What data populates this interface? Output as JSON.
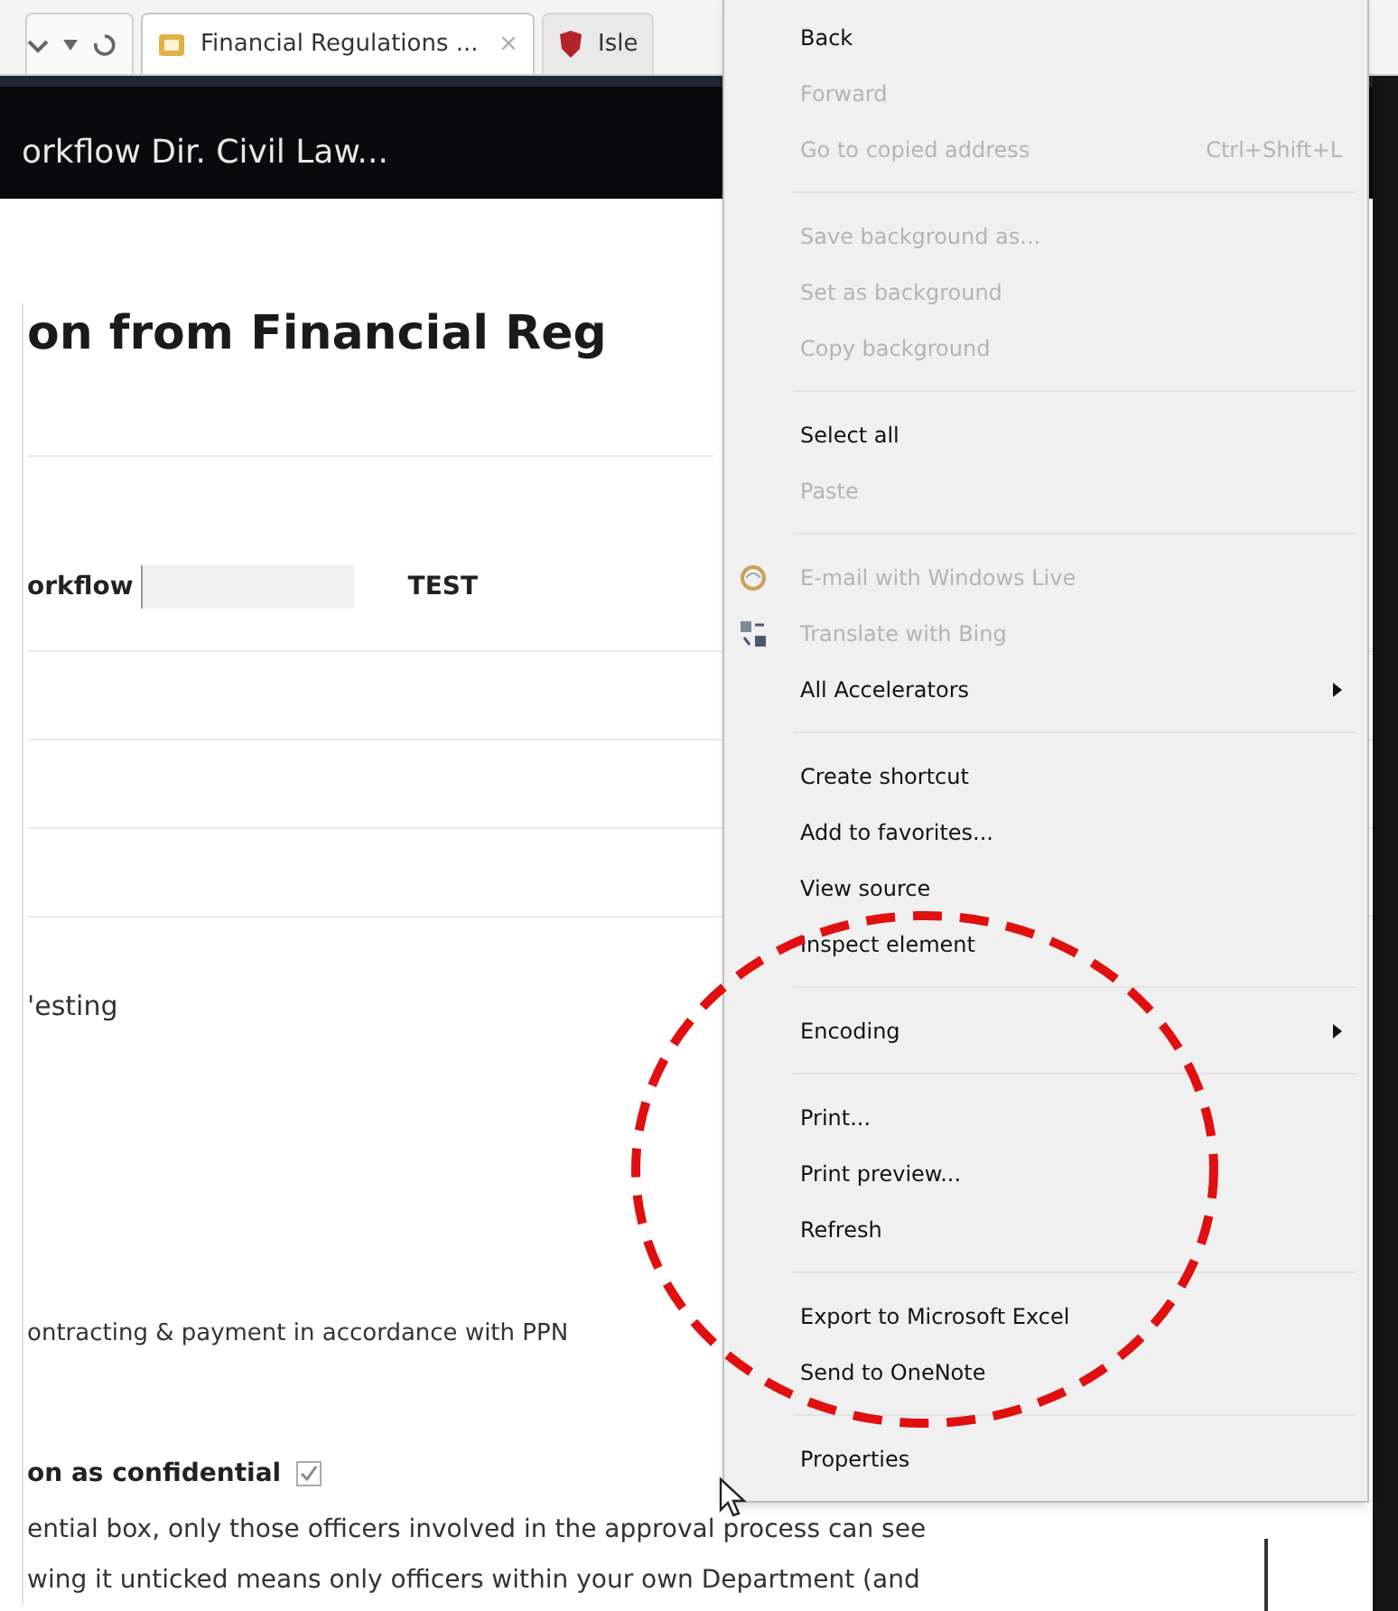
{
  "browser": {
    "tabs": [
      {
        "title": "Financial Regulations ...",
        "close": "×",
        "selected": true
      },
      {
        "title": "Isle",
        "selected": false
      }
    ]
  },
  "header": {
    "title": "orkflow Dir. Civil Law..."
  },
  "page": {
    "heading": "on from Financial Reg",
    "fields": [
      {
        "label": "orkflow",
        "value": "TEST",
        "redacted": true
      },
      {
        "label": "'esting"
      }
    ],
    "statement": "ontracting & payment in accordance with PPN",
    "confidential": {
      "label": "on as confidential",
      "checked": true
    },
    "paragraph": [
      "ential box, only those officers involved in the approval process can see",
      "wing it unticked means only officers within your own Department (and"
    ]
  },
  "context_menu": {
    "groups": [
      [
        {
          "label": "Back",
          "disabled": false
        },
        {
          "label": "Forward",
          "disabled": true
        },
        {
          "label": "Go to copied address",
          "shortcut": "Ctrl+Shift+L",
          "disabled": true
        }
      ],
      [
        {
          "label": "Save background as...",
          "disabled": true
        },
        {
          "label": "Set as background",
          "disabled": true
        },
        {
          "label": "Copy background",
          "disabled": true
        }
      ],
      [
        {
          "label": "Select all",
          "disabled": false
        },
        {
          "label": "Paste",
          "disabled": true
        }
      ],
      [
        {
          "label": "E-mail with Windows Live",
          "kind": "icon",
          "disabled": true
        },
        {
          "label": "Translate with Bing",
          "kind": "icon",
          "disabled": true
        },
        {
          "label": "All Accelerators",
          "submenu": true,
          "disabled": false
        }
      ],
      [
        {
          "label": "Create shortcut",
          "disabled": false
        },
        {
          "label": "Add to favorites...",
          "disabled": false
        },
        {
          "label": "View source",
          "disabled": false
        },
        {
          "label": "Inspect element",
          "disabled": false
        }
      ],
      [
        {
          "label": "Encoding",
          "submenu": true,
          "disabled": false
        }
      ],
      [
        {
          "label": "Print...",
          "disabled": false
        },
        {
          "label": "Print preview...",
          "disabled": false
        },
        {
          "label": "Refresh",
          "disabled": false
        }
      ],
      [
        {
          "label": "Export to Microsoft Excel",
          "disabled": false
        },
        {
          "label": "Send to OneNote",
          "disabled": false
        }
      ],
      [
        {
          "label": "Properties",
          "disabled": false
        }
      ]
    ]
  }
}
